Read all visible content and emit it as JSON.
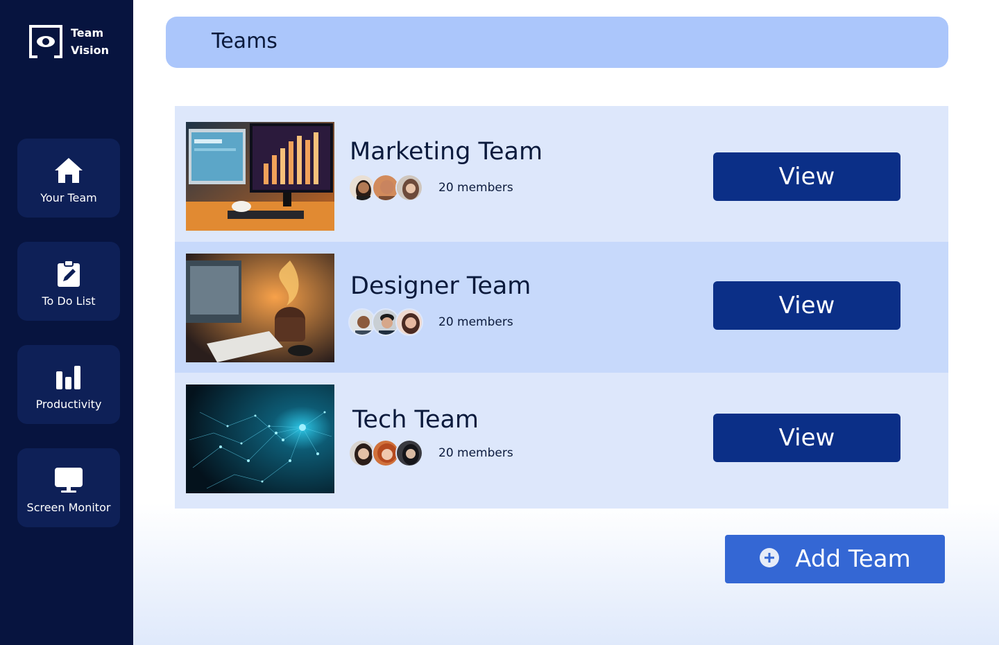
{
  "app": {
    "logo_line1": "Team",
    "logo_line2": "Vision"
  },
  "sidebar": {
    "items": [
      {
        "label": "Your Team",
        "icon": "home-icon"
      },
      {
        "label": "To Do List",
        "icon": "clipboard-edit-icon"
      },
      {
        "label": "Productivity",
        "icon": "bar-chart-icon"
      },
      {
        "label": "Screen Monitor",
        "icon": "monitor-icon"
      }
    ]
  },
  "header": {
    "title": "Teams"
  },
  "teams": [
    {
      "name": "Marketing Team",
      "members": "20 members",
      "button": "View"
    },
    {
      "name": "Designer Team",
      "members": "20 members",
      "button": "View"
    },
    {
      "name": "Tech Team",
      "members": "20 members",
      "button": "View"
    }
  ],
  "actions": {
    "add_team": "Add Team"
  },
  "colors": {
    "sidebar_bg": "#07143f",
    "nav_item_bg": "#0e2057",
    "header_bg": "#abc6fb",
    "row_light": "#dde7fb",
    "row_dark": "#c7d9fb",
    "view_button": "#0b2f87",
    "add_button": "#3467d4"
  }
}
